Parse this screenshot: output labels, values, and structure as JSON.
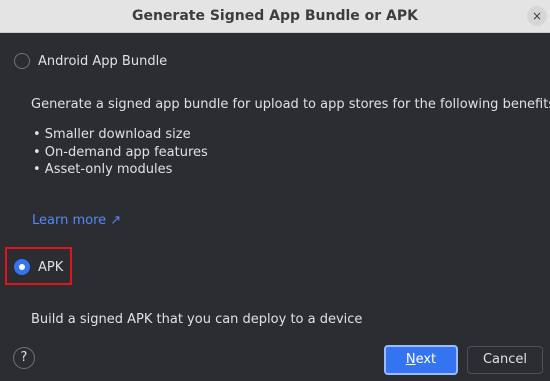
{
  "window": {
    "title": "Generate Signed App Bundle or APK",
    "close_icon": "×"
  },
  "options": {
    "app_bundle": {
      "label": "Android App Bundle",
      "selected": false,
      "description": "Generate a signed app bundle for upload to app stores for the following benefits:",
      "benefits": [
        "• Smaller download size",
        "• On-demand app features",
        "• Asset-only modules"
      ],
      "learn_more": "Learn more ↗"
    },
    "apk": {
      "label": "APK",
      "selected": true,
      "description": "Build a signed APK that you can deploy to a device"
    }
  },
  "footer": {
    "help_label": "?",
    "next_mnemonic": "N",
    "next_rest": "ext",
    "cancel_label": "Cancel"
  },
  "colors": {
    "accent": "#3574f0",
    "link": "#548af7",
    "highlight": "#e0141e",
    "background": "#2b2d30"
  }
}
